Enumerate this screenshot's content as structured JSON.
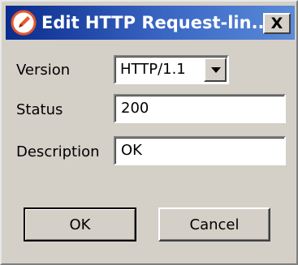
{
  "window": {
    "title": "Edit HTTP Request-lin...",
    "close_label": "X",
    "icon": "edit-pencil-icon"
  },
  "form": {
    "version": {
      "label": "Version",
      "value": "HTTP/1.1",
      "dropdown_icon": "chevron-down-icon"
    },
    "status": {
      "label": "Status",
      "value": "200"
    },
    "description": {
      "label": "Description",
      "value": "OK"
    }
  },
  "buttons": {
    "ok_label": "OK",
    "cancel_label": "Cancel"
  },
  "colors": {
    "titlebar_start": "#0a2c8c",
    "titlebar_end": "#5a8ad8",
    "dialog_background": "#d4d0c8",
    "icon_accent": "#e8582a"
  }
}
